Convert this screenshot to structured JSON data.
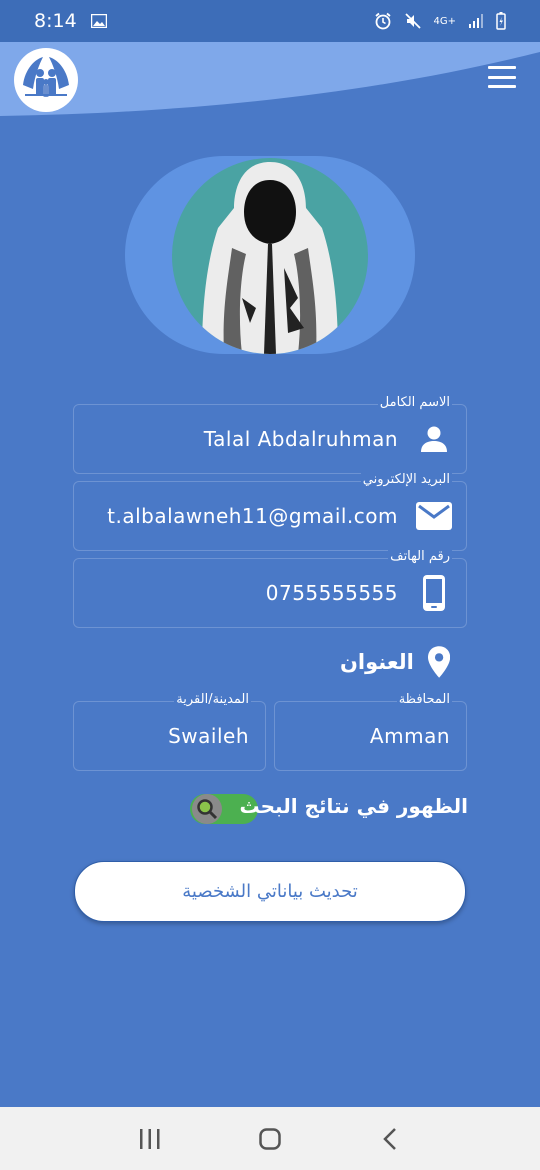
{
  "status_bar": {
    "time": "8:14",
    "network": "4G+"
  },
  "header": {
    "logo_icon": "family-hands-logo",
    "menu_icon": "hamburger-menu-icon"
  },
  "profile": {
    "avatar_icon": "hooded-person-avatar"
  },
  "form": {
    "full_name": {
      "label": "الاسم الكامل",
      "value": "Talal Abdalruhman",
      "icon": "person-icon"
    },
    "email": {
      "label": "البريد الإلكتروني",
      "value": "t.albalawneh11@gmail.com",
      "icon": "mail-icon"
    },
    "phone": {
      "label": "رقم الهاتف",
      "value": "0755555555",
      "icon": "phone-icon"
    },
    "address": {
      "label": "العنوان",
      "icon": "location-pin-icon",
      "governorate": {
        "label": "المحافظة",
        "value": "Amman"
      },
      "city": {
        "label": "المدينة/القرية",
        "value": "Swaileh"
      }
    },
    "search_visibility": {
      "label": "الظهور في نتائج البحث",
      "enabled": true
    },
    "update_button": "تحديث بياناتي الشخصية"
  },
  "colors": {
    "background": "#4a79c7",
    "accent_light": "#5f93e2",
    "toggle_on": "#4cb050"
  }
}
